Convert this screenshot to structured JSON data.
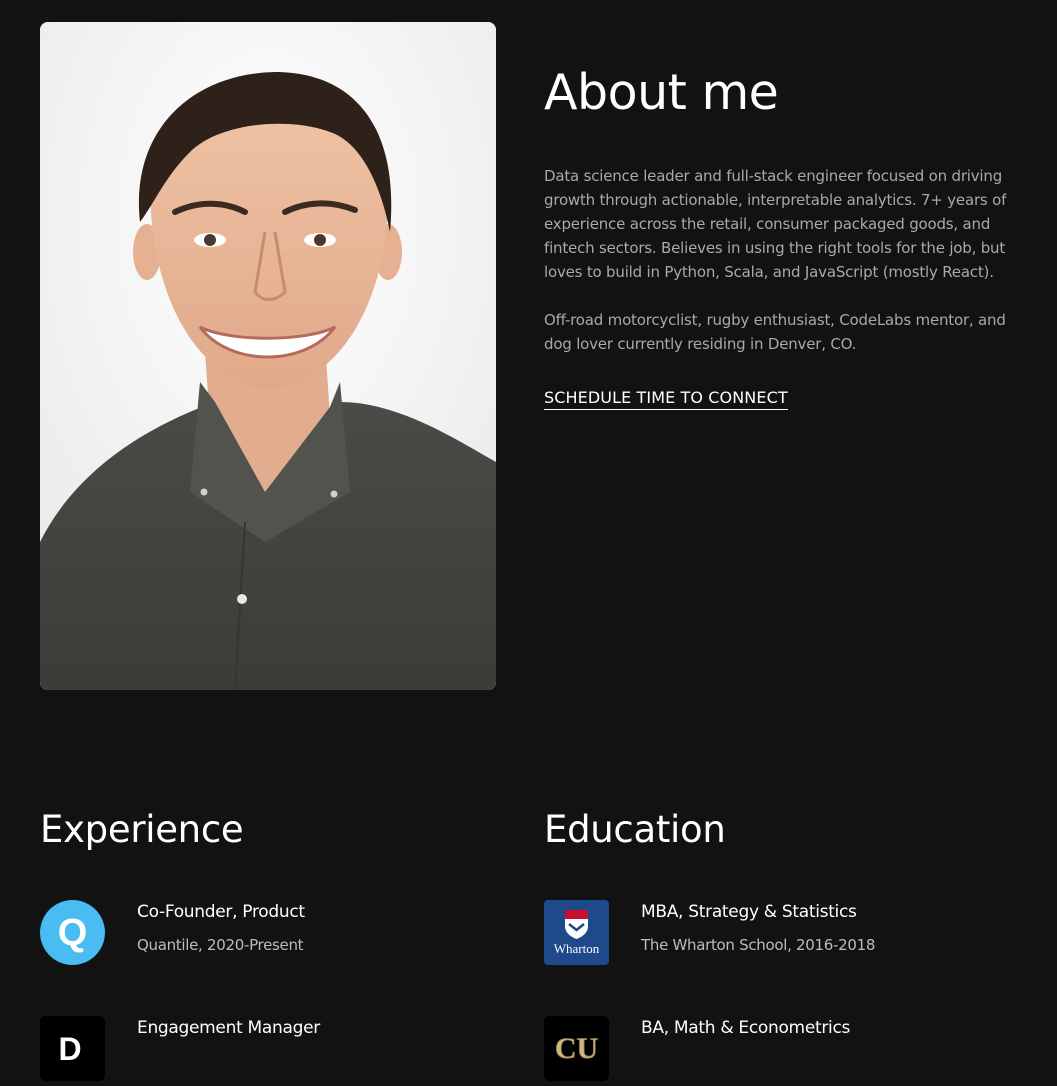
{
  "about": {
    "title": "About me",
    "paragraph1": "Data science leader and full-stack engineer focused on driving growth through actionable, interpretable analytics. 7+ years of experience across the retail, consumer packaged goods, and fintech sectors. Believes in using the right tools for the job, but loves to build in Python, Scala, and JavaScript (mostly React).",
    "paragraph2": "Off-road motorcyclist, rugby enthusiast, CodeLabs mentor, and dog lover currently residing in Denver, CO.",
    "cta_label": "SCHEDULE TIME TO CONNECT"
  },
  "experience": {
    "title": "Experience",
    "items": [
      {
        "title": "Co-Founder, Product",
        "subtitle": "Quantile, 2020-Present",
        "logo_icon": "quantile-logo-icon",
        "logo_letter": "Q"
      },
      {
        "title": "Engagement Manager",
        "subtitle": "",
        "logo_icon": "company-d-logo-icon",
        "logo_letter": "D"
      }
    ]
  },
  "education": {
    "title": "Education",
    "items": [
      {
        "title": "MBA, Strategy & Statistics",
        "subtitle": "The Wharton School, 2016-2018",
        "logo_icon": "wharton-logo-icon",
        "logo_text": "Wharton"
      },
      {
        "title": "BA, Math & Econometrics",
        "subtitle": "",
        "logo_icon": "cu-logo-icon",
        "logo_text": "CU"
      }
    ]
  },
  "colors": {
    "background": "#121212",
    "text_primary": "#ffffff",
    "text_secondary": "#a9a9a9",
    "quantile_blue": "#3cb4f0",
    "wharton_navy": "#1e4a8c"
  }
}
